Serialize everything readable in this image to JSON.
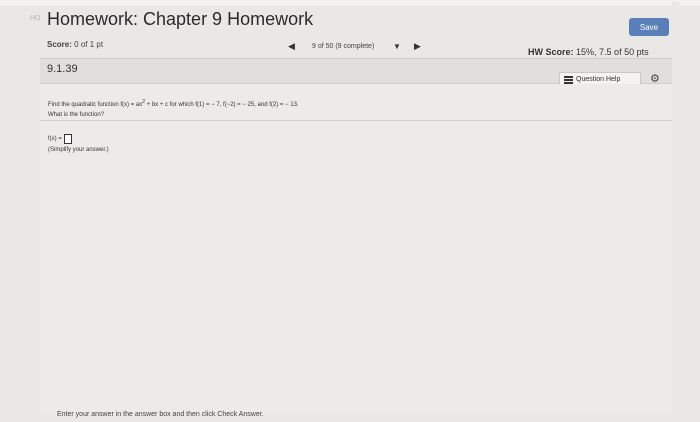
{
  "header": {
    "tag": "HO",
    "title": "Homework: Chapter 9 Homework",
    "save_label": "Save",
    "corner": "He"
  },
  "score": {
    "label": "Score:",
    "value": "0 of 1 pt"
  },
  "navigation": {
    "prev": "◀",
    "status": "9 of 50 (9 complete)",
    "dropdown": "▼",
    "next": "▶"
  },
  "hw_score": {
    "label": "HW Score:",
    "value": "15%, 7.5 of 50 pts"
  },
  "question": {
    "number": "9.1.39",
    "help_label": "Question Help",
    "text_before_exp": "Find the quadratic function f(x) = ax",
    "exponent": "2",
    "text_after_exp": " + bx + c for which f(1) = − 7, f(−2) = − 25, and f(2) = − 13.",
    "prompt": "What is the function?",
    "answer_label": "f(x) =",
    "hint": "(Simplify your answer.)"
  },
  "footer": {
    "instruction": "Enter your answer in the answer box and then click Check Answer."
  }
}
